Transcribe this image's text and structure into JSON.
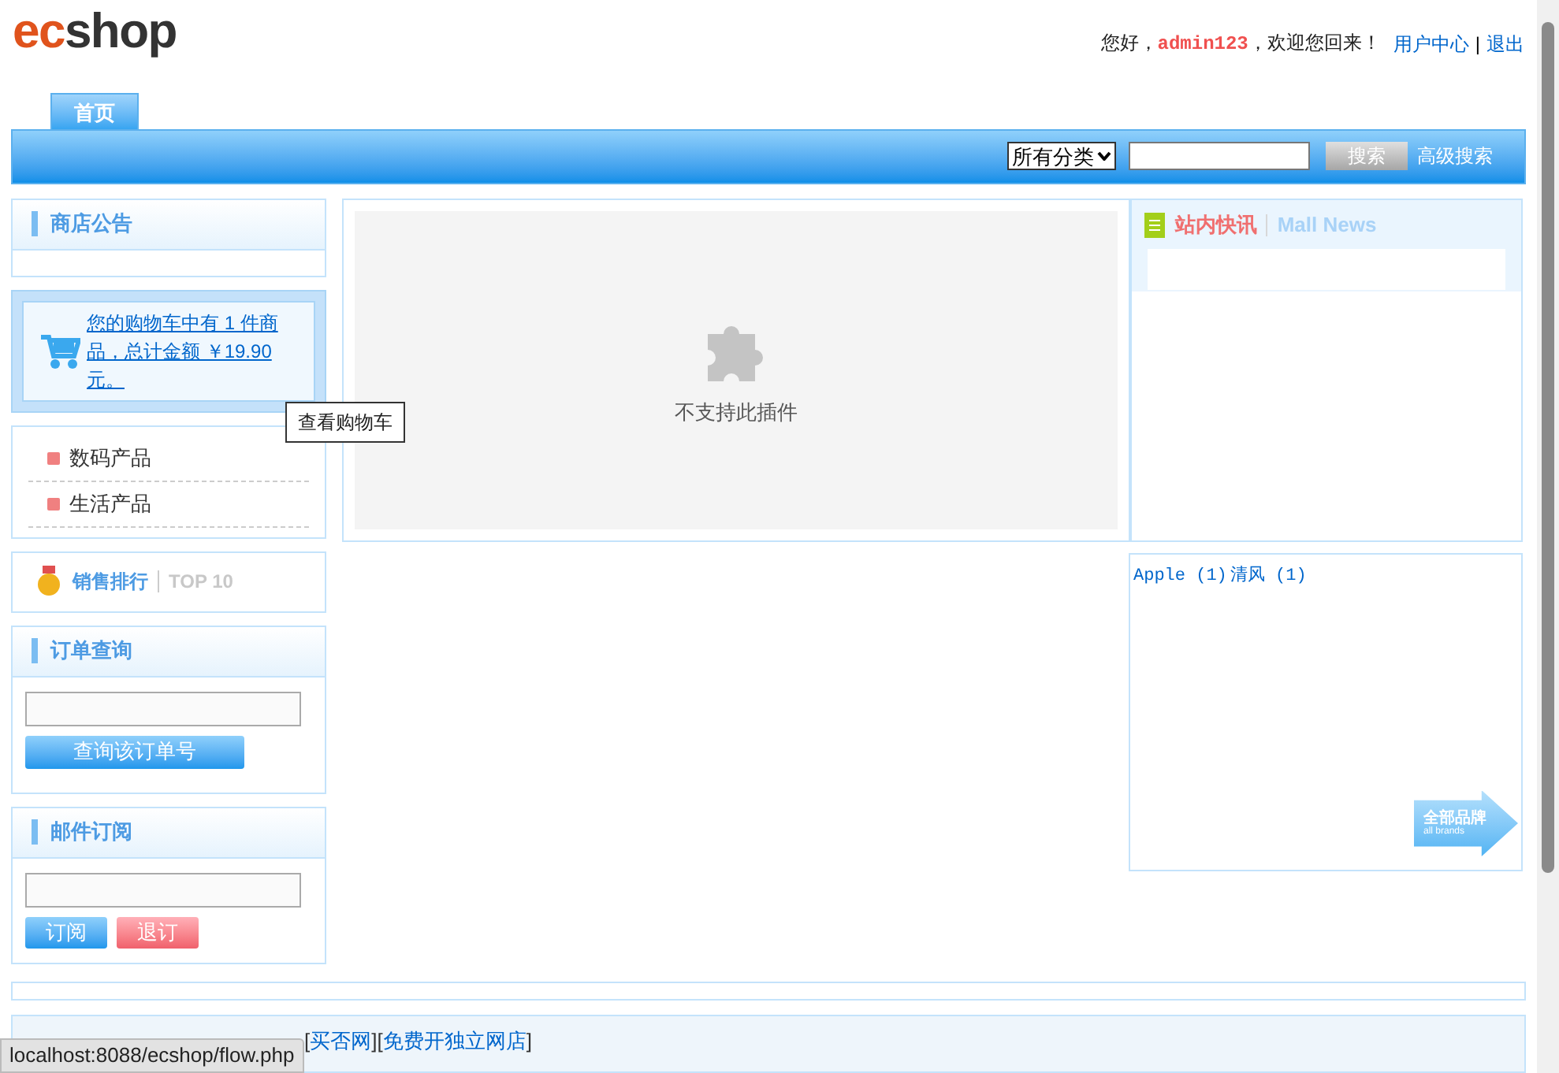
{
  "logo": {
    "part_a": "ec",
    "part_b": "shop"
  },
  "header": {
    "greeting_prefix": "您好，",
    "username": "admin123",
    "greeting_suffix": "，欢迎您回来！",
    "links": [
      "用户中心",
      "退出"
    ],
    "separator": "|"
  },
  "tabs": [
    {
      "label": "首页",
      "selected": true
    }
  ],
  "search": {
    "category": "所有分类",
    "button": "搜索",
    "advanced": "高级搜索"
  },
  "notice": {
    "title": "商店公告"
  },
  "cart": {
    "text": "您的购物车中有 1 件商品，总计金额 ￥19.90元。",
    "tooltip": "查看购物车"
  },
  "categories": [
    "数码产品",
    "生活产品"
  ],
  "top10": {
    "title": "销售排行",
    "subtitle": "TOP 10"
  },
  "order_query": {
    "title": "订单查询",
    "button": "查询该订单号"
  },
  "mail": {
    "title": "邮件订阅",
    "subscribe": "订阅",
    "unsubscribe": "退订"
  },
  "plugin": {
    "message": "不支持此插件"
  },
  "news": {
    "title": "站内快讯",
    "subtitle": "Mall News"
  },
  "brands": {
    "items": [
      "Apple (1)",
      "清风 (1)"
    ],
    "all_cn": "全部品牌",
    "all_en": "all brands"
  },
  "footer_links": [
    {
      "open": "[",
      "label": "买否网",
      "close": "]"
    },
    {
      "open": "[",
      "label": "免费开独立网店",
      "close": "]"
    }
  ],
  "status_url": "localhost:8088/ecshop/flow.php"
}
